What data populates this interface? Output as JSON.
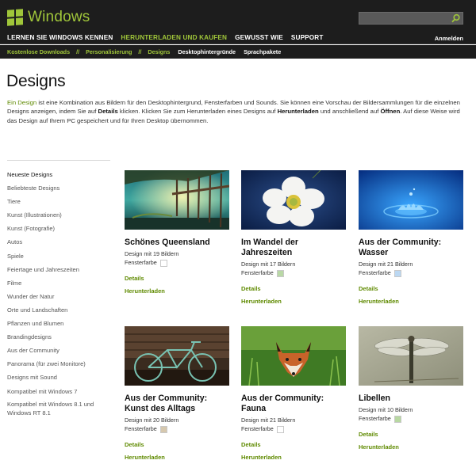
{
  "header": {
    "brand": "Windows",
    "search_placeholder": "",
    "nav": [
      "LERNEN SIE WINDOWS KENNEN",
      "HERUNTERLADEN UND KAUFEN",
      "GEWUSST WIE",
      "SUPPORT"
    ],
    "active_nav": "HERUNTERLADEN UND KAUFEN",
    "signin": "Anmelden",
    "brand_color": "#a0c63a"
  },
  "breadcrumb": {
    "items": [
      "Kostenlose Downloads",
      "Personalisierung",
      "Designs"
    ],
    "separator": "//",
    "sub_items": [
      "Desktophintergründe",
      "Sprachpakete"
    ]
  },
  "page": {
    "title": "Designs",
    "intro": {
      "lead": "Ein Design",
      "part1": " ist eine Kombination aus Bildern für den Desktophintergrund, Fensterfarben und Sounds. Sie können eine Vorschau der Bildersammlungen für die einzelnen Designs anzeigen, indem Sie auf ",
      "bold1": "Details",
      "part2": " klicken. Klicken Sie zum Herunterladen eines Designs auf ",
      "bold2": "Herunterladen",
      "part3": " und anschließend auf ",
      "bold3": "Öffnen",
      "part4": ". Auf diese Weise wird das Design auf Ihrem PC gespeichert und für Ihren Desktop übernommen."
    }
  },
  "sidebar": {
    "items": [
      "Neueste Designs",
      "Beliebteste Designs",
      "Tiere",
      "Kunst (Illustrationen)",
      "Kunst (Fotografie)",
      "Autos",
      "Spiele",
      "Feiertage und Jahreszeiten",
      "Filme",
      "Wunder der Natur",
      "Orte und Landschaften",
      "Pflanzen und Blumen",
      "Brandingdesigns",
      "Aus der Community",
      "Panorama (für zwei Monitore)",
      "Designs mit Sound",
      "Kompatibel mit Windows 7",
      "Kompatibel mit Windows 8.1 und Windows RT 8.1"
    ],
    "current": "Neueste Designs"
  },
  "cards": [
    {
      "title": "Schönes Queensland",
      "count": "Design mit 19 Bildern",
      "color_label": "Fensterfarbe",
      "swatch": "#ffffff",
      "details": "Details",
      "download": "Herunterladen",
      "image": "lake-jetty-image"
    },
    {
      "title": "Im Wandel der Jahreszeiten",
      "count": "Design mit 17 Bildern",
      "color_label": "Fensterfarbe",
      "swatch": "#b9d8a6",
      "details": "Details",
      "download": "Herunterladen",
      "image": "white-flower-image"
    },
    {
      "title": "Aus der Community: Wasser",
      "count": "Design mit 21 Bildern",
      "color_label": "Fensterfarbe",
      "swatch": "#bcd8f2",
      "details": "Details",
      "download": "Herunterladen",
      "image": "water-splash-image"
    },
    {
      "title": "Aus der Community: Kunst des Alltags",
      "count": "Design mit 20 Bildern",
      "color_label": "Fensterfarbe",
      "swatch": "#d6c8ae",
      "details": "Details",
      "download": "Herunterladen",
      "image": "bicycle-image"
    },
    {
      "title": "Aus der Community: Fauna",
      "count": "Design mit 21 Bildern",
      "color_label": "Fensterfarbe",
      "swatch": "#ffffff",
      "details": "Details",
      "download": "Herunterladen",
      "image": "fox-image"
    },
    {
      "title": "Libellen",
      "count": "Design mit 10 Bildern",
      "color_label": "Fensterfarbe",
      "swatch": "#b8d8a2",
      "details": "Details",
      "download": "Herunterladen",
      "image": "dragonfly-image"
    }
  ]
}
